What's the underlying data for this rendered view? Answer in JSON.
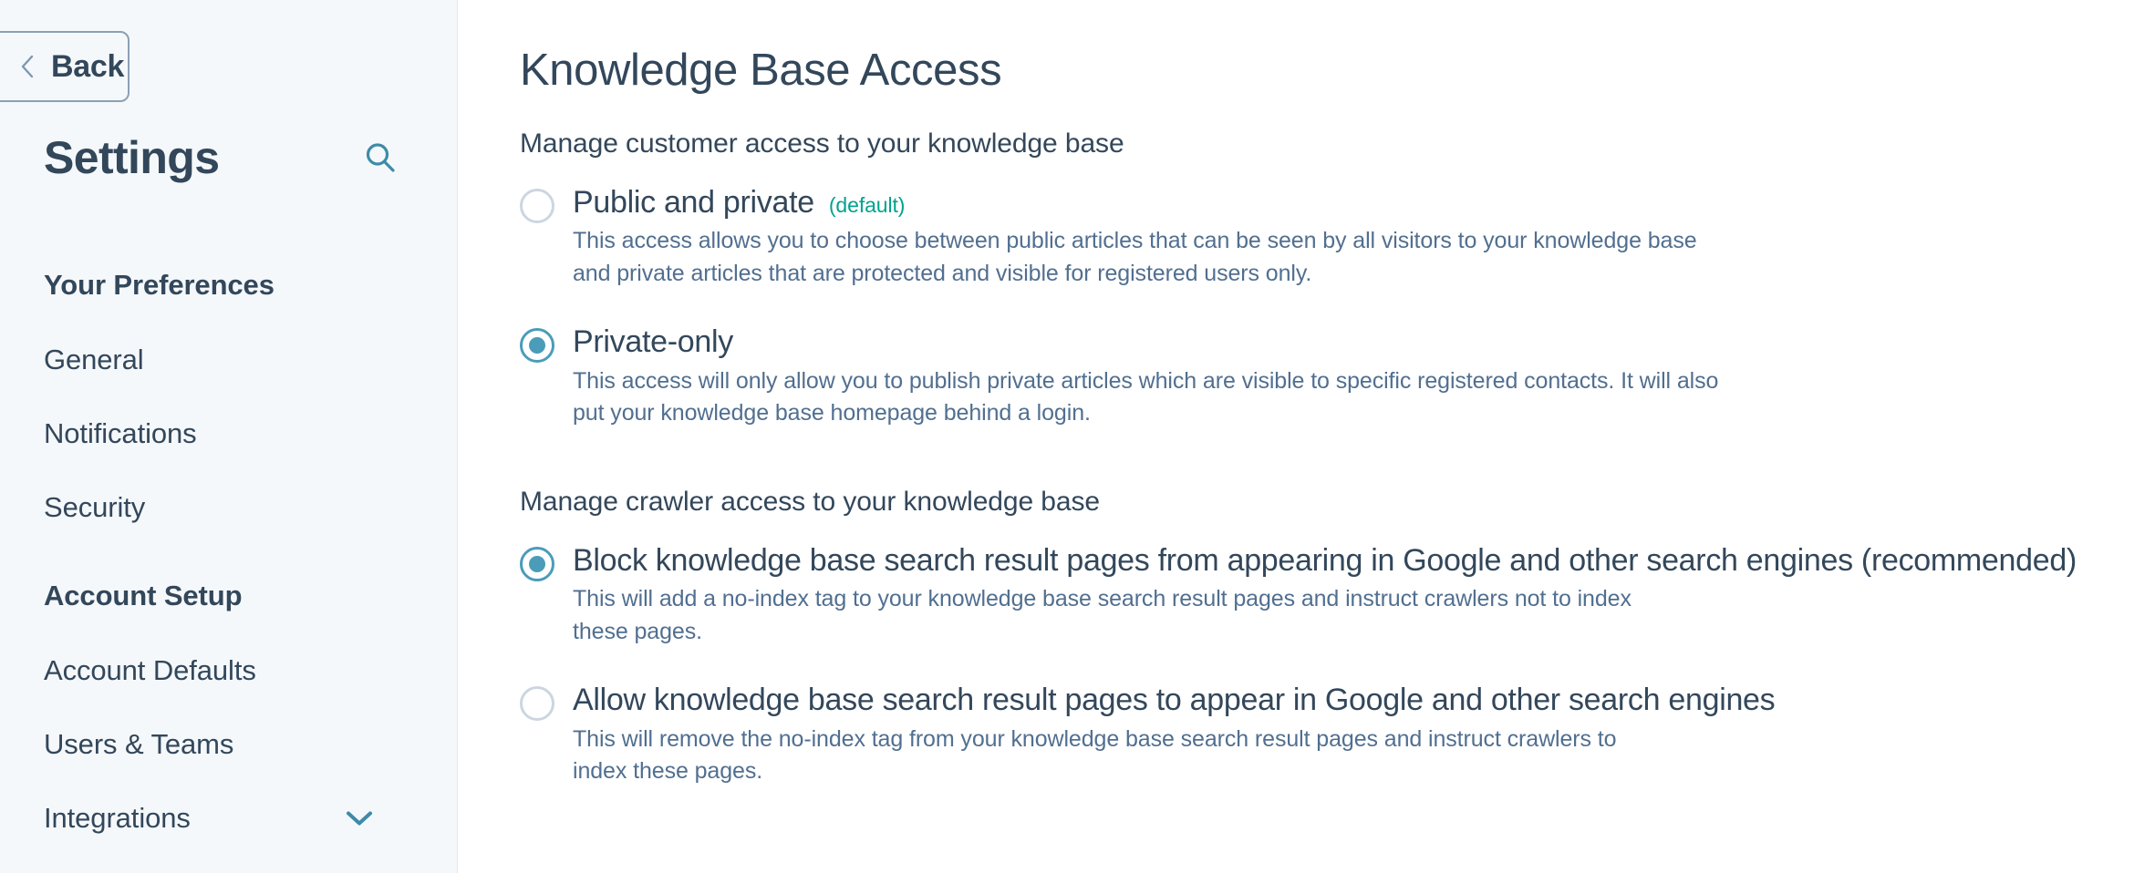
{
  "sidebar": {
    "back_label": "Back",
    "title": "Settings",
    "search_icon": "search-icon",
    "groups": [
      {
        "label": "Your Preferences",
        "items": [
          {
            "label": "General",
            "icon": null
          },
          {
            "label": "Notifications",
            "icon": null
          },
          {
            "label": "Security",
            "icon": null
          }
        ]
      },
      {
        "label": "Account Setup",
        "items": [
          {
            "label": "Account Defaults",
            "icon": null
          },
          {
            "label": "Users & Teams",
            "icon": null
          },
          {
            "label": "Integrations",
            "icon": "chevron-down-icon"
          }
        ]
      }
    ]
  },
  "main": {
    "page_title": "Knowledge Base Access",
    "sections": [
      {
        "heading": "Manage customer access to your knowledge base",
        "options": [
          {
            "title": "Public and private",
            "badge": "(default)",
            "selected": false,
            "description": "This access allows you to choose between public articles that can be seen by all visitors to your knowledge base and private articles that are protected and visible for registered users only."
          },
          {
            "title": "Private-only",
            "badge": "",
            "selected": true,
            "description": "This access will only allow you to publish private articles which are visible to specific registered contacts. It will also put your knowledge base homepage behind a login."
          }
        ]
      },
      {
        "heading": "Manage crawler access to your knowledge base",
        "options": [
          {
            "title": "Block knowledge base search result pages from appearing in Google and other search engines (recommended)",
            "badge": "",
            "selected": true,
            "description": "This will add a no-index tag to your knowledge base search result pages and instruct crawlers not to index these pages."
          },
          {
            "title": "Allow knowledge base search result pages to appear in Google and other search engines",
            "badge": "",
            "selected": false,
            "description": "This will remove the no-index tag from your knowledge base search result pages and instruct crawlers to index these pages."
          }
        ]
      }
    ]
  },
  "colors": {
    "accent_teal": "#4a9cb9",
    "text_primary": "#33475b",
    "text_secondary": "#516f90",
    "badge_green": "#00a38d",
    "sidebar_bg": "#f5f8fa",
    "radio_off_border": "#cbd6e2"
  }
}
